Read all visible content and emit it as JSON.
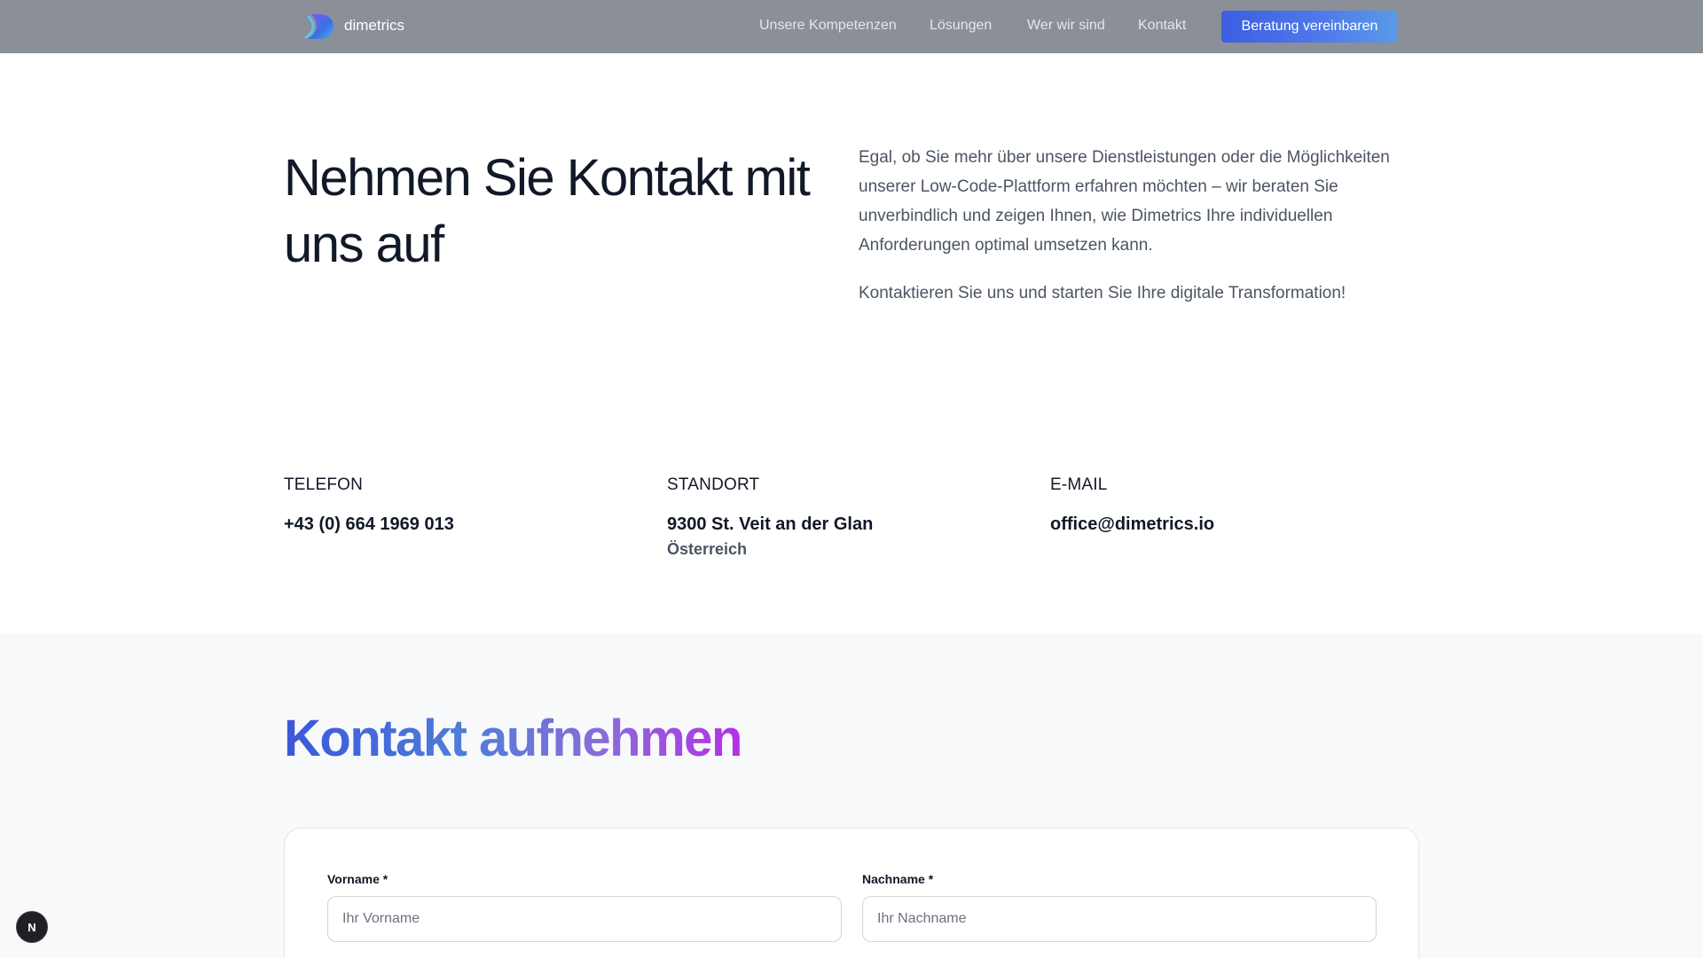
{
  "header": {
    "brand": "dimetrics",
    "nav": [
      "Unsere Kompetenzen",
      "Lösungen",
      "Wer wir sind",
      "Kontakt"
    ],
    "cta_label": "Beratung vereinbaren"
  },
  "hero": {
    "title": "Nehmen Sie Kontakt mit uns auf",
    "paragraph1": "Egal, ob Sie mehr über unsere Dienstleistungen oder die Möglichkeiten unserer Low-Code-Plattform erfahren möchten – wir beraten Sie unverbindlich und zeigen Ihnen, wie Dimetrics Ihre individuellen Anforderungen optimal umsetzen kann.",
    "paragraph2": "Kontaktieren Sie uns und starten Sie Ihre digitale Transformation!"
  },
  "contact_info": {
    "phone": {
      "label": "TELEFON",
      "value": "+43 (0) 664 1969 013"
    },
    "location": {
      "label": "STANDORT",
      "value": "9300 St. Veit an der Glan",
      "sub": "Österreich"
    },
    "email": {
      "label": "E-MAIL",
      "value": "office@dimetrics.io"
    }
  },
  "form": {
    "title": "Kontakt aufnehmen",
    "first_name": {
      "label": "Vorname *",
      "placeholder": "Ihr Vorname"
    },
    "last_name": {
      "label": "Nachname *",
      "placeholder": "Ihr Nachname"
    }
  },
  "badge": {
    "letter": "N"
  },
  "colors": {
    "header_bg": "#8a8f98",
    "cta_start": "#3b5fe0",
    "cta_end": "#5a9ae8",
    "title_gradient_start": "#3b57d9",
    "title_gradient_end": "#b430e6"
  }
}
